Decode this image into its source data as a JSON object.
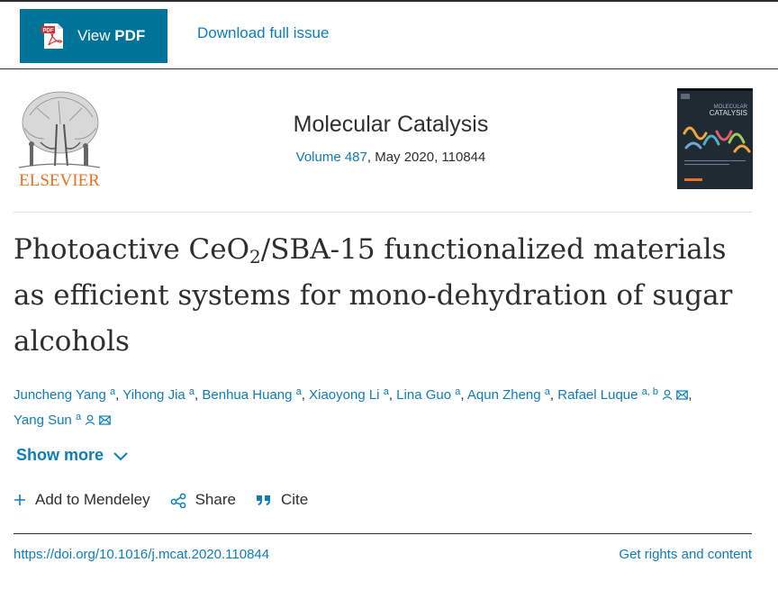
{
  "toolbar": {
    "view_pdf_prefix": "View ",
    "view_pdf_bold": "PDF",
    "pdf_icon_text": "PDF",
    "download_issue": "Download full issue"
  },
  "header": {
    "publisher_logo_text": "ELSEVIER",
    "journal_name": "Molecular Catalysis",
    "volume_link": "Volume 487",
    "issue_date": ", May 2020, 110844",
    "cover_line1": "MOLECULAR",
    "cover_line2": "CATALYSIS"
  },
  "article": {
    "title_part1": "Photoactive CeO",
    "title_sub": "2",
    "title_part2": "/SBA-15 functionalized materials as efficient systems for mono-dehydration of sugar alcohols"
  },
  "authors": [
    {
      "name": "Juncheng Yang",
      "sup": "a"
    },
    {
      "name": "Yihong Jia",
      "sup": "a"
    },
    {
      "name": "Benhua Huang",
      "sup": "a"
    },
    {
      "name": "Xiaoyong Li",
      "sup": "a"
    },
    {
      "name": "Lina Guo",
      "sup": "a"
    },
    {
      "name": "Aqun Zheng",
      "sup": "a"
    },
    {
      "name": "Rafael Luque",
      "sup": "a, b"
    },
    {
      "name": "Yang Sun",
      "sup": "a"
    }
  ],
  "author_sep": ",",
  "show_more": "Show more",
  "actions": {
    "mendeley": "Add to Mendeley",
    "share": "Share",
    "cite": "Cite"
  },
  "footer": {
    "doi": "https://doi.org/10.1016/j.mcat.2020.110844",
    "rights": "Get rights and content"
  },
  "colors": {
    "accent": "#007398",
    "link": "#0c7dbb",
    "elsevier_orange": "#e9711c",
    "text": "#2e2e2e"
  }
}
